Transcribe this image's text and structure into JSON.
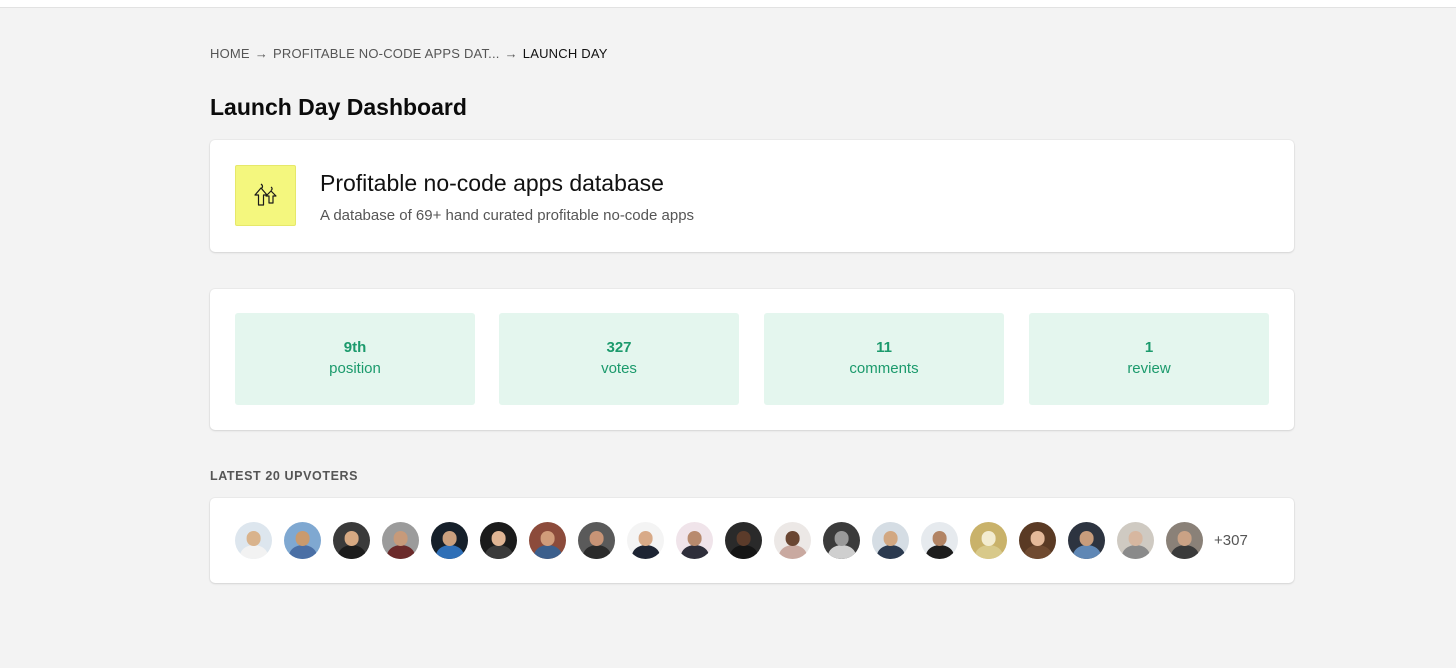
{
  "breadcrumb": {
    "items": [
      "HOME",
      "PROFITABLE NO-CODE APPS DAT...",
      "LAUNCH DAY"
    ],
    "separator": "→"
  },
  "page": {
    "title": "Launch Day Dashboard"
  },
  "product": {
    "name": "Profitable no-code apps database",
    "tagline": "A database of 69+ hand curated profitable no-code apps",
    "logo_icon": "up-arrows-icon",
    "logo_bg": "#f4f77e"
  },
  "stats": [
    {
      "value": "9th",
      "label": "position"
    },
    {
      "value": "327",
      "label": "votes"
    },
    {
      "value": "11",
      "label": "comments"
    },
    {
      "value": "1",
      "label": "review"
    }
  ],
  "stats_colors": {
    "bg": "#e4f6ee",
    "text": "#1b9a6c"
  },
  "upvoters": {
    "heading": "LATEST 20 UPVOTERS",
    "more": "+307",
    "avatars": [
      {
        "bg": "#dde6ee",
        "skin": "#d9b38c",
        "shirt": "#f2f2f2"
      },
      {
        "bg": "#7fa8d1",
        "skin": "#c99a6e",
        "shirt": "#4a6fa5"
      },
      {
        "bg": "#3a3a3a",
        "skin": "#d7a982",
        "shirt": "#1c1c1c"
      },
      {
        "bg": "#9b9b9b",
        "skin": "#c79a7a",
        "shirt": "#6b2a2a"
      },
      {
        "bg": "#16202a",
        "skin": "#caa07e",
        "shirt": "#2e6fb7"
      },
      {
        "bg": "#1b1b1b",
        "skin": "#e0b594",
        "shirt": "#3a3a3a"
      },
      {
        "bg": "#8c4b3b",
        "skin": "#d19c7a",
        "shirt": "#3c5f8c"
      },
      {
        "bg": "#5a5a5a",
        "skin": "#c89476",
        "shirt": "#2b2b2b"
      },
      {
        "bg": "#f4f4f4",
        "skin": "#d8aa88",
        "shirt": "#1d2433"
      },
      {
        "bg": "#f0e4ea",
        "skin": "#b88a6e",
        "shirt": "#2e2e3a"
      },
      {
        "bg": "#2a2a2a",
        "skin": "#5b3b2a",
        "shirt": "#151515"
      },
      {
        "bg": "#ece8e6",
        "skin": "#6a4632",
        "shirt": "#c9a9a0"
      },
      {
        "bg": "#3b3b3b",
        "skin": "#9a9a9a",
        "shirt": "#cfcfcf"
      },
      {
        "bg": "#d5dde4",
        "skin": "#d2a882",
        "shirt": "#2b3a4f"
      },
      {
        "bg": "#e6eaee",
        "skin": "#b28464",
        "shirt": "#1d1d1d"
      },
      {
        "bg": "#c9b26a",
        "skin": "#f3ecd0",
        "shirt": "#d8c98a"
      },
      {
        "bg": "#5a3a24",
        "skin": "#e4b999",
        "shirt": "#6f4a30"
      },
      {
        "bg": "#2d3440",
        "skin": "#c79c7c",
        "shirt": "#5f87b5"
      },
      {
        "bg": "#cfcac2",
        "skin": "#d7b7a0",
        "shirt": "#8a8a8a"
      },
      {
        "bg": "#8a8178",
        "skin": "#caa285",
        "shirt": "#3a3a3a"
      }
    ]
  }
}
